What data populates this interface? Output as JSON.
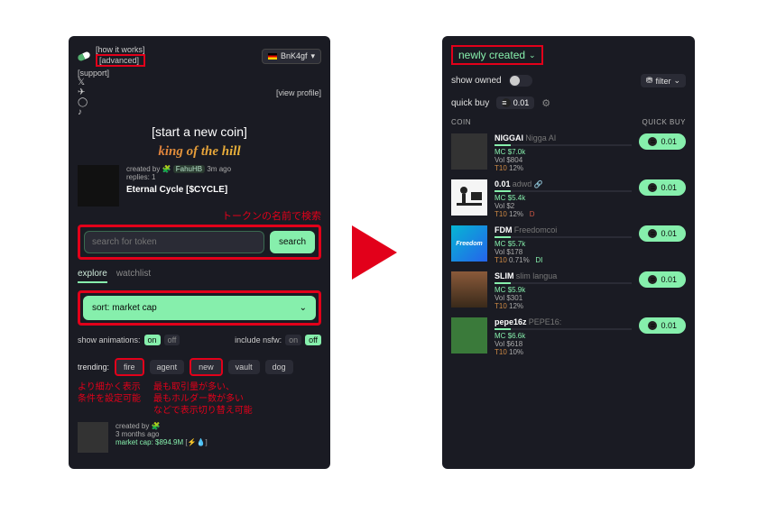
{
  "header": {
    "how_it_works": "[how it works]",
    "advanced": "[advanced]",
    "support": "[support]",
    "view_profile": "[view profile]",
    "wallet": "BnK4gf"
  },
  "start_coin": "[start a new coin]",
  "king": "king of the hill",
  "featured": {
    "created_by": "created by",
    "creator": "FahuHB",
    "age": "3m ago",
    "replies": "replies: 1",
    "title": "Eternal Cycle [$CYCLE]"
  },
  "jp_search": "トークンの名前で検索",
  "search": {
    "placeholder": "search for token",
    "button": "search"
  },
  "tabs": {
    "explore": "explore",
    "watchlist": "watchlist"
  },
  "sort": "sort: market cap",
  "toggles": {
    "anim_label": "show animations:",
    "anim_on": "on",
    "anim_off": "off",
    "nsfw_label": "include nsfw:",
    "nsfw_on": "on",
    "nsfw_off": "off"
  },
  "trending": {
    "label": "trending:",
    "fire": "fire",
    "agent": "agent",
    "new": "new",
    "vault": "vault",
    "dog": "dog"
  },
  "jp_left": "より細かく表示\n条件を設定可能",
  "jp_right": "最も取引量が多い、\n最もホルダー数が多い\nなどで表示切り替え可能",
  "bottom_card": {
    "created_by": "created by",
    "age": "3 months ago",
    "mc": "market cap: $894.9M"
  },
  "right": {
    "newly_created": "newly created",
    "show_owned": "show owned",
    "filter": "filter",
    "quick_buy": "quick buy",
    "amount": "0.01",
    "col_coin": "COIN",
    "col_qb": "QUICK BUY",
    "coins": [
      {
        "sym": "NIGGAI",
        "name": "Nigga AI",
        "mc": "$7.0k",
        "vol": "$804",
        "t10": "12%"
      },
      {
        "sym": "0.01",
        "name": "adwd",
        "mc": "$5.4k",
        "vol": "$2",
        "t10": "12%",
        "badge": "D"
      },
      {
        "sym": "FDM",
        "name": "Freedomcoi",
        "mc": "$5.7k",
        "vol": "$178",
        "t10": "0.71%",
        "badge": "DI"
      },
      {
        "sym": "SLIM",
        "name": "slim langua",
        "mc": "$5.9k",
        "vol": "$301",
        "t10": "12%"
      },
      {
        "sym": "pepe16z",
        "name": "PEPE16:",
        "mc": "$6.6k",
        "vol": "$618",
        "t10": "10%"
      }
    ]
  },
  "labels": {
    "mc": "MC",
    "vol": "Vol",
    "t10": "T10"
  }
}
